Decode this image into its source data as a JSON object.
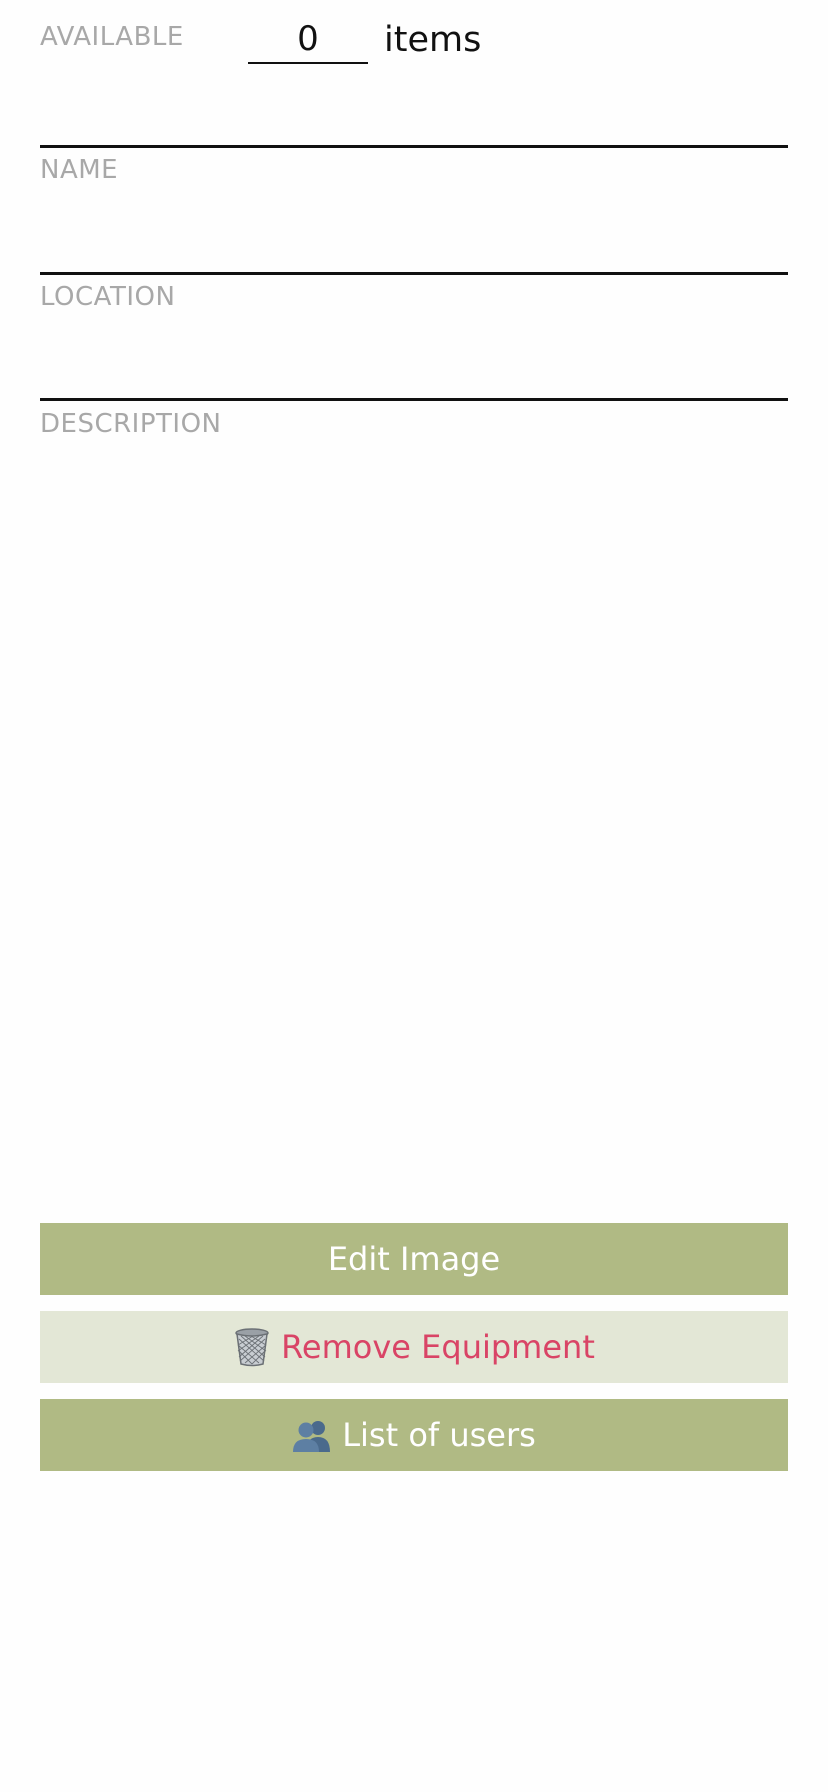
{
  "available": {
    "label": "AVAILABLE",
    "value": "0",
    "unit": "items"
  },
  "fields": {
    "name": {
      "label": "NAME",
      "value": ""
    },
    "location": {
      "label": "LOCATION",
      "value": ""
    },
    "description": {
      "label": "DESCRIPTION",
      "value": ""
    }
  },
  "buttons": {
    "edit_image": "Edit Image",
    "remove_equipment": "Remove Equipment",
    "list_of_users": "List of users"
  },
  "icons": {
    "remove": "trash-icon",
    "users": "users-icon"
  },
  "colors": {
    "primary_button": "#b0ba84",
    "secondary_button": "#e3e7d6",
    "destructive_text": "#d94466",
    "label_text": "#a8a8a8"
  }
}
